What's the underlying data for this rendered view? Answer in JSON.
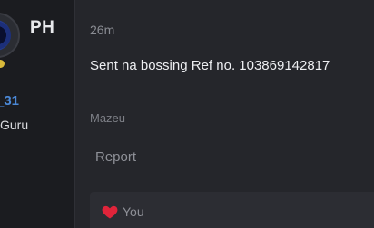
{
  "author": {
    "badge": "PH",
    "username_fragment": "_31",
    "title_fragment": "Guru"
  },
  "post": {
    "time": "26m",
    "body": "Sent na bossing Ref no. 103869142817",
    "signature": "Mazeu",
    "report_label": "Report"
  },
  "reactions": {
    "icon": "heart-icon",
    "user": "You"
  },
  "colors": {
    "username": "#4b88d6",
    "heart": "#e0243a",
    "background": "#212226"
  }
}
